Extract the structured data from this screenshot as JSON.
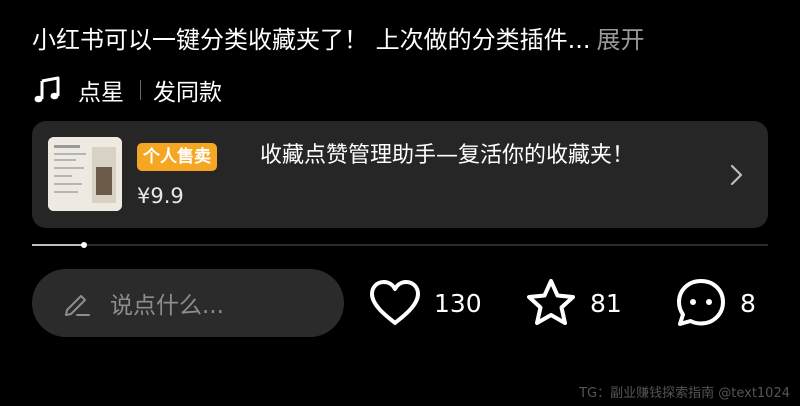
{
  "description": {
    "text": "小红书可以一键分类收藏夹了！ 上次做的分类插件...",
    "expand_label": "展开"
  },
  "music": {
    "icon": "music-note-icon",
    "artist": "点星",
    "action_label": "发同款"
  },
  "product": {
    "badge": "个人售卖",
    "title": "收藏点赞管理助手—复活你的收藏夹！",
    "price": "¥9.9",
    "colors": {
      "badge": "#f5a623",
      "card": "#262626"
    }
  },
  "progress": {
    "value": 0.07
  },
  "comment": {
    "placeholder": "说点什么..."
  },
  "actions": {
    "likes": "130",
    "favorites": "81",
    "comments": "8"
  },
  "watermark": "TG：副业赚钱探索指南 @text1024"
}
